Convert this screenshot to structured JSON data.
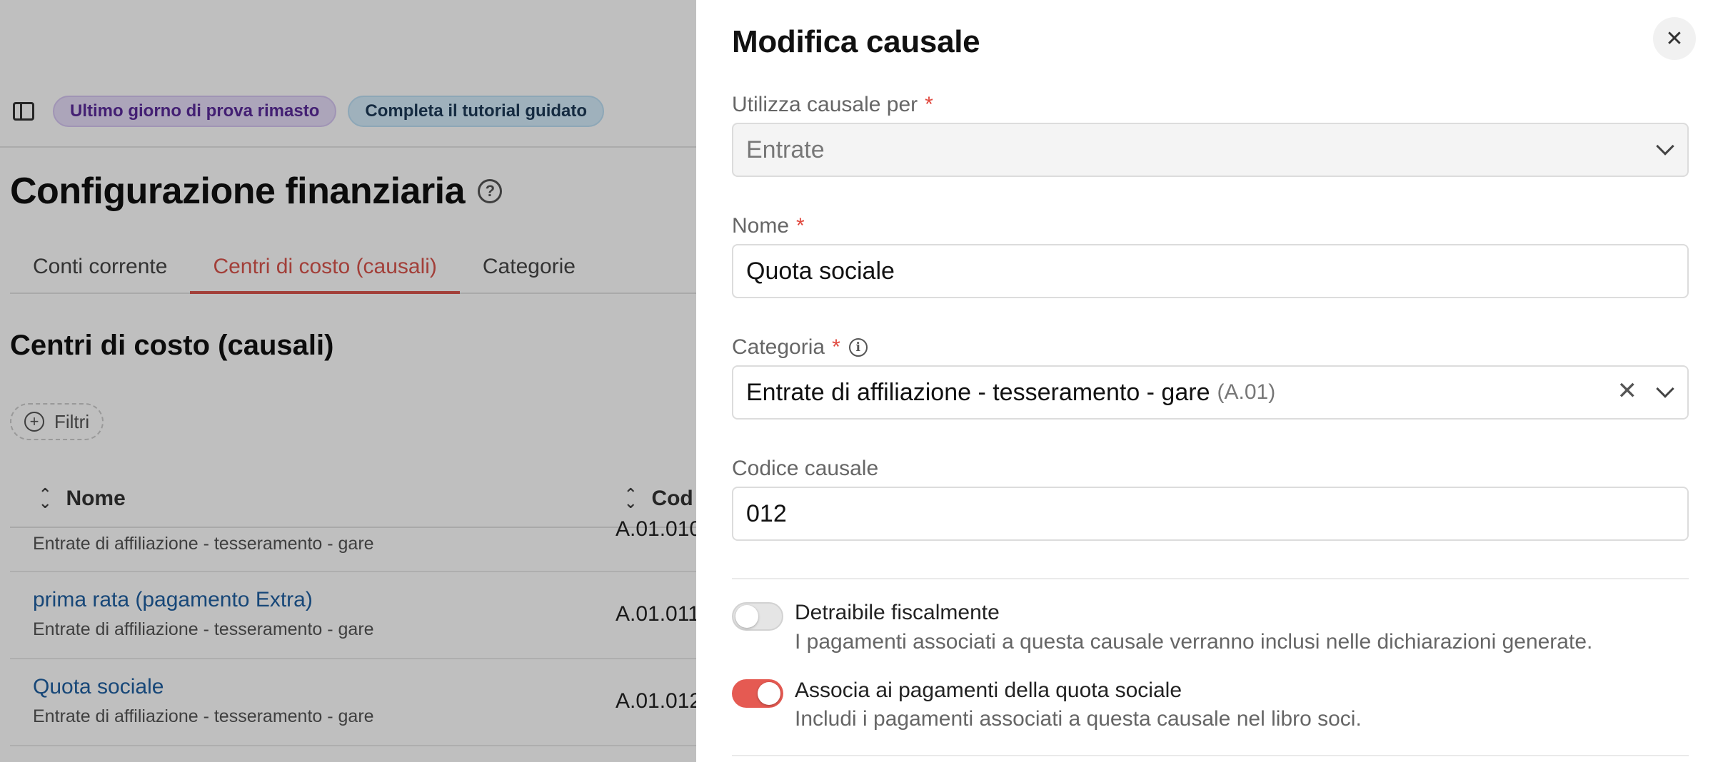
{
  "colors": {
    "accent": "#d9544c",
    "link": "#1f5fa0",
    "required": "#e0483e",
    "toggle_on": "#e55a52"
  },
  "background_page": {
    "sidebar_toggle_icon": "sidebar-panel-icon",
    "promo_pills": [
      "Ultimo giorno di prova rimasto",
      "Completa il tutorial guidato"
    ],
    "title": "Configurazione finanziaria",
    "help_icon": "question-circle-icon",
    "tabs": [
      {
        "label": "Conti corrente",
        "active": false
      },
      {
        "label": "Centri di costo (causali)",
        "active": true
      },
      {
        "label": "Categorie",
        "active": false
      }
    ],
    "section_title": "Centri di costo (causali)",
    "filter_label": "Filtri",
    "table": {
      "columns": [
        "Nome",
        "Cod"
      ],
      "rows": [
        {
          "name": "",
          "category": "Entrate di affiliazione - tesseramento - gare",
          "code": "A.01.010"
        },
        {
          "name": "prima rata (pagamento Extra)",
          "category": "Entrate di affiliazione - tesseramento - gare",
          "code": "A.01.011"
        },
        {
          "name": "Quota sociale",
          "category": "Entrate di affiliazione - tesseramento - gare",
          "code": "A.01.012"
        }
      ]
    }
  },
  "drawer": {
    "title": "Modifica causale",
    "close_icon": "close-icon",
    "fields": {
      "use_for": {
        "label": "Utilizza causale per",
        "required": true,
        "value": "Entrate",
        "disabled": true
      },
      "name": {
        "label": "Nome",
        "required": true,
        "value": "Quota sociale"
      },
      "category": {
        "label": "Categoria",
        "required": true,
        "value": "Entrate di affiliazione - tesseramento - gare",
        "code": "(A.01)"
      },
      "code": {
        "label": "Codice causale",
        "value": "012"
      }
    },
    "toggles": {
      "deductible": {
        "title": "Detraibile fiscalmente",
        "description": "I pagamenti associati a questa causale verranno inclusi nelle dichiarazioni generate.",
        "on": false
      },
      "membership": {
        "title": "Associa ai pagamenti della quota sociale",
        "description": "Includi i pagamenti associati a questa causale nel libro soci.",
        "on": true
      }
    },
    "required_mark": "*",
    "info_glyph": "i",
    "clear_glyph": "✕",
    "close_glyph": "✕"
  }
}
